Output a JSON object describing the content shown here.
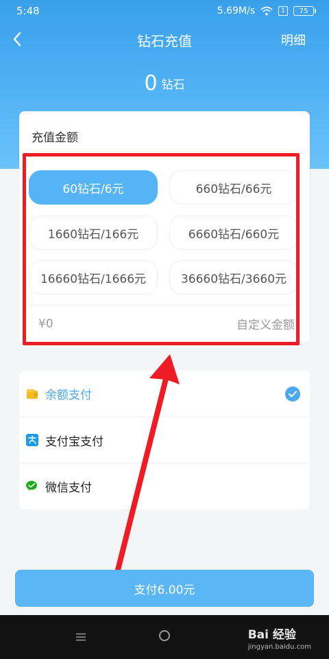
{
  "status_bar": {
    "time": "5:48",
    "speed": "5.69M/s",
    "sim": "1",
    "battery": "75"
  },
  "nav": {
    "title": "钻石充值",
    "detail_label": "明细"
  },
  "balance": {
    "amount": "0",
    "unit": "钻石"
  },
  "recharge": {
    "title": "充值金额",
    "options": [
      {
        "label": "60钻石/6元",
        "selected": true
      },
      {
        "label": "660钻石/66元",
        "selected": false
      },
      {
        "label": "1660钻石/166元",
        "selected": false
      },
      {
        "label": "6660钻石/660元",
        "selected": false
      },
      {
        "label": "16660钻石/1666元",
        "selected": false
      },
      {
        "label": "36660钻石/3660元",
        "selected": false
      }
    ],
    "custom_amount": "¥0",
    "custom_label": "自定义金额"
  },
  "payment": {
    "methods": [
      {
        "label": "余额支付",
        "icon": "wallet-icon",
        "selected": true
      },
      {
        "label": "支付宝支付",
        "icon": "alipay-icon",
        "selected": false
      },
      {
        "label": "微信支付",
        "icon": "wechat-icon",
        "selected": false
      }
    ]
  },
  "pay_button": {
    "label": "支付6.00元"
  },
  "watermark": {
    "brand": "Bai 经验",
    "url": "jingyan.baidu.com"
  },
  "colors": {
    "accent": "#55b4f6",
    "highlight_box": "#ee1c24"
  }
}
